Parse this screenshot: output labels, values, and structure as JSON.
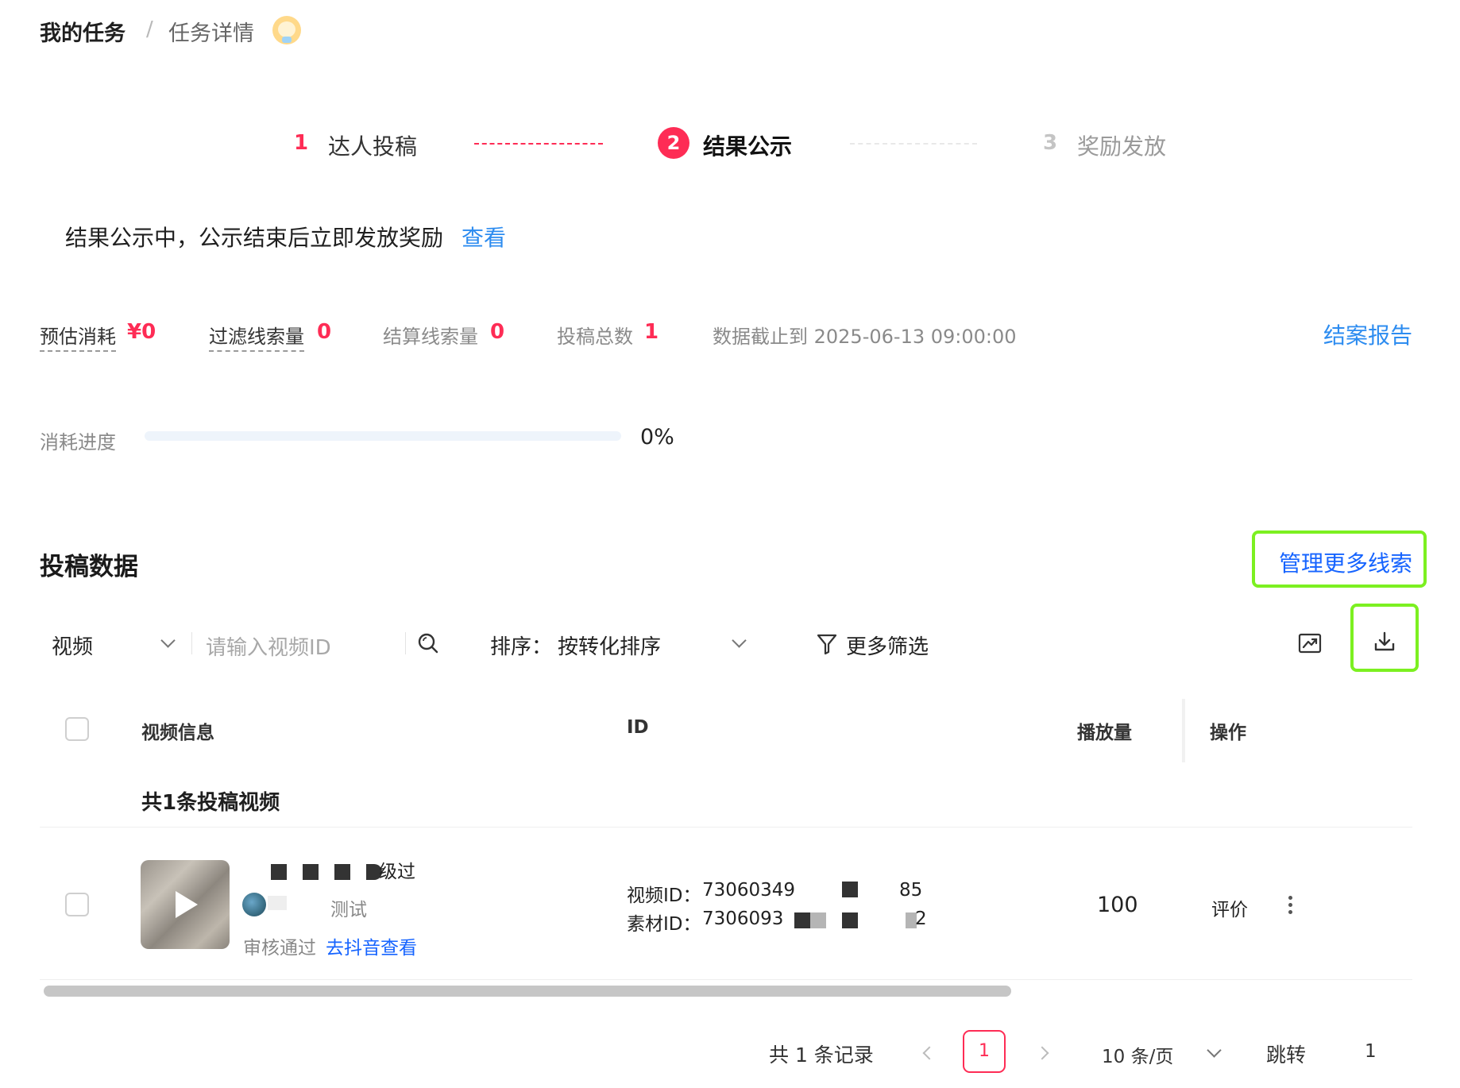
{
  "breadcrumb": {
    "root": "我的任务",
    "separator": "/",
    "current": "任务详情"
  },
  "steps": [
    {
      "num": "1",
      "label": "达人投稿"
    },
    {
      "num": "2",
      "label": "结果公示"
    },
    {
      "num": "3",
      "label": "奖励发放"
    }
  ],
  "notice": {
    "text": "结果公示中，公示结束后立即发放奖励",
    "link": "查看"
  },
  "stats": {
    "budget_label": "预估消耗",
    "budget_value": "¥0",
    "filtered_label": "过滤线索量",
    "filtered_value": "0",
    "settled_label": "结算线索量",
    "settled_value": "0",
    "submissions_label": "投稿总数",
    "submissions_value": "1",
    "cutoff": "数据截止到 2025-06-13 09:00:00",
    "report_link": "结案报告"
  },
  "progress": {
    "label": "消耗进度",
    "percent_text": "0%",
    "fraction": 0
  },
  "section": {
    "title": "投稿数据",
    "manage_link": "管理更多线索"
  },
  "toolbar": {
    "type_select": "视频",
    "search_placeholder": "请输入视频ID",
    "sort_label": "排序：",
    "sort_value": "按转化排序",
    "filter_label": "更多筛选"
  },
  "table": {
    "headers": {
      "video_info": "视频信息",
      "id": "ID",
      "plays": "播放量",
      "actions": "操作"
    },
    "group_label": "共1条投稿视频",
    "rows": [
      {
        "title_suffix": "级过",
        "author_suffix": "测试",
        "status": "审核通过",
        "view_link": "去抖音查看",
        "video_id_label": "视频ID：",
        "video_id_prefix": "73060349",
        "video_id_suffix": "85",
        "material_id_label": "素材ID：",
        "material_id_prefix": "7306093",
        "material_id_suffix": "2",
        "plays": "100",
        "action": "评价"
      }
    ]
  },
  "pagination": {
    "total": "共 1 条记录",
    "current_page": "1",
    "page_size": "10 条/页",
    "jump_label": "跳转",
    "jump_value": "1"
  },
  "colors": {
    "accent": "#fe2c55",
    "link": "#2d8cf0",
    "highlight": "#7cf021"
  }
}
